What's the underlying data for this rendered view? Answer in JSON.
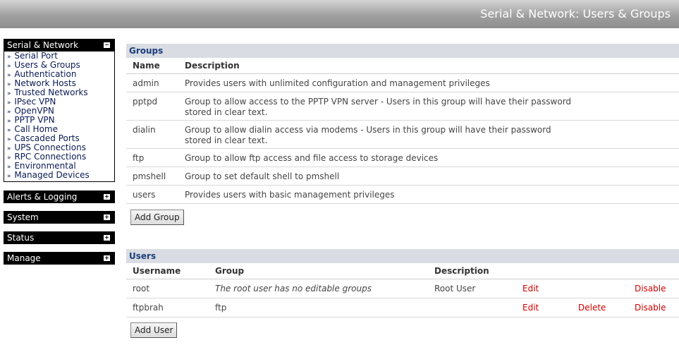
{
  "header": {
    "title": "Serial & Network: Users & Groups"
  },
  "sidebar": {
    "serial_network": {
      "label": "Serial & Network",
      "toggle": "−",
      "items": [
        "Serial Port",
        "Users & Groups",
        "Authentication",
        "Network Hosts",
        "Trusted Networks",
        "IPsec VPN",
        "OpenVPN",
        "PPTP VPN",
        "Call Home",
        "Cascaded Ports",
        "UPS Connections",
        "RPC Connections",
        "Environmental",
        "Managed Devices"
      ]
    },
    "alerts": {
      "label": "Alerts & Logging",
      "toggle": "+"
    },
    "system": {
      "label": "System",
      "toggle": "+"
    },
    "status": {
      "label": "Status",
      "toggle": "+"
    },
    "manage": {
      "label": "Manage",
      "toggle": "+"
    },
    "bullet": "»"
  },
  "groups": {
    "title": "Groups",
    "col_name": "Name",
    "col_desc": "Description",
    "rows": [
      {
        "name": "admin",
        "desc": "Provides users with unlimited configuration and management privileges"
      },
      {
        "name": "pptpd",
        "desc": "Group to allow access to the PPTP VPN server - Users in this group will have their password stored in clear text."
      },
      {
        "name": "dialin",
        "desc": "Group to allow dialin access via modems - Users in this group will have their password stored in clear text."
      },
      {
        "name": "ftp",
        "desc": "Group to allow ftp access and file access to storage devices"
      },
      {
        "name": "pmshell",
        "desc": "Group to set default shell to pmshell"
      },
      {
        "name": "users",
        "desc": "Provides users with basic management privileges"
      }
    ],
    "add_button": "Add Group"
  },
  "users": {
    "title": "Users",
    "col_username": "Username",
    "col_group": "Group",
    "col_desc": "Description",
    "rows": [
      {
        "username": "root",
        "group": "The root user has no editable groups",
        "desc": "Root User",
        "edit": "Edit",
        "delete": "",
        "disable": "Disable"
      },
      {
        "username": "ftpbrah",
        "group": "ftp",
        "desc": "",
        "edit": "Edit",
        "delete": "Delete",
        "disable": "Disable"
      }
    ],
    "add_button": "Add User"
  },
  "colors": {
    "link_red": "#cc0000",
    "section_header_bg": "#d9dde3",
    "section_header_text": "#1b3d7a",
    "menu_bg": "#000000"
  }
}
